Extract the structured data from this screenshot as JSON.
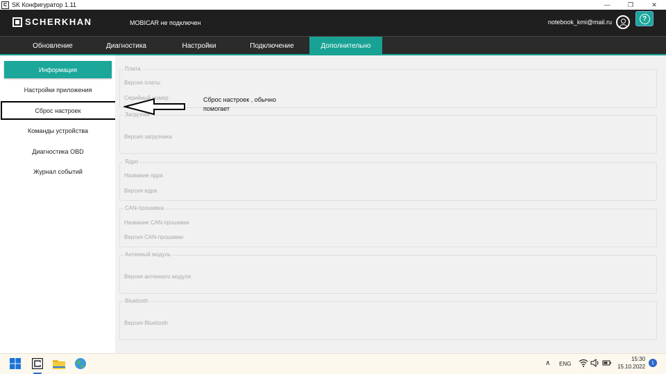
{
  "window": {
    "title": "SK Конфигуратор 1.11",
    "icon_label": "C",
    "controls": {
      "minimize": "—",
      "restore": "❐",
      "close": "✕"
    }
  },
  "header": {
    "logo_text": "SCHERKHAN",
    "connection_status": "MOBICAR не подключен",
    "user_email": "notebook_kmi@mail.ru",
    "help_symbol": "?"
  },
  "nav": {
    "tabs": [
      {
        "label": "Обновление"
      },
      {
        "label": "Диагностика"
      },
      {
        "label": "Настройки"
      },
      {
        "label": "Подключение"
      },
      {
        "label": "Дополнительно"
      }
    ],
    "active_index": 4
  },
  "sidebar": {
    "items": [
      {
        "label": "Информация"
      },
      {
        "label": "Настройки приложения"
      },
      {
        "label": "Сброс настроек"
      },
      {
        "label": "Команды устройства"
      },
      {
        "label": "Диагностика OBD"
      },
      {
        "label": "Журнал событий"
      }
    ],
    "active_index": 0,
    "highlighted_index": 2
  },
  "main": {
    "groups": [
      {
        "title": "Плата",
        "fields": [
          "Версия платы",
          "Серийный номер"
        ]
      },
      {
        "title": "Загрузчик",
        "fields": [
          "Версия загрузчика"
        ]
      },
      {
        "title": "Ядро",
        "fields": [
          "Название ядра",
          "Версия ядра"
        ]
      },
      {
        "title": "CAN-прошивка",
        "fields": [
          "Название CAN-прошивки",
          "Версия CAN-прошивки"
        ]
      },
      {
        "title": "Антенный модуль",
        "fields": [
          "Версия антенного модуля"
        ]
      },
      {
        "title": "Bluetooth",
        "fields": [
          "Версия Bluetooth"
        ]
      }
    ]
  },
  "annotation": {
    "text": "Сброс настроек , обычно помогает"
  },
  "taskbar": {
    "tray": {
      "language": "ENG",
      "time": "15:30",
      "date": "15.10.2022",
      "notifications": "1"
    }
  },
  "colors": {
    "accent": "#1ba79a",
    "header_bg": "#1c1c1c",
    "nav_bg": "#2b2b2b",
    "content_bg": "#f1f1f1"
  }
}
